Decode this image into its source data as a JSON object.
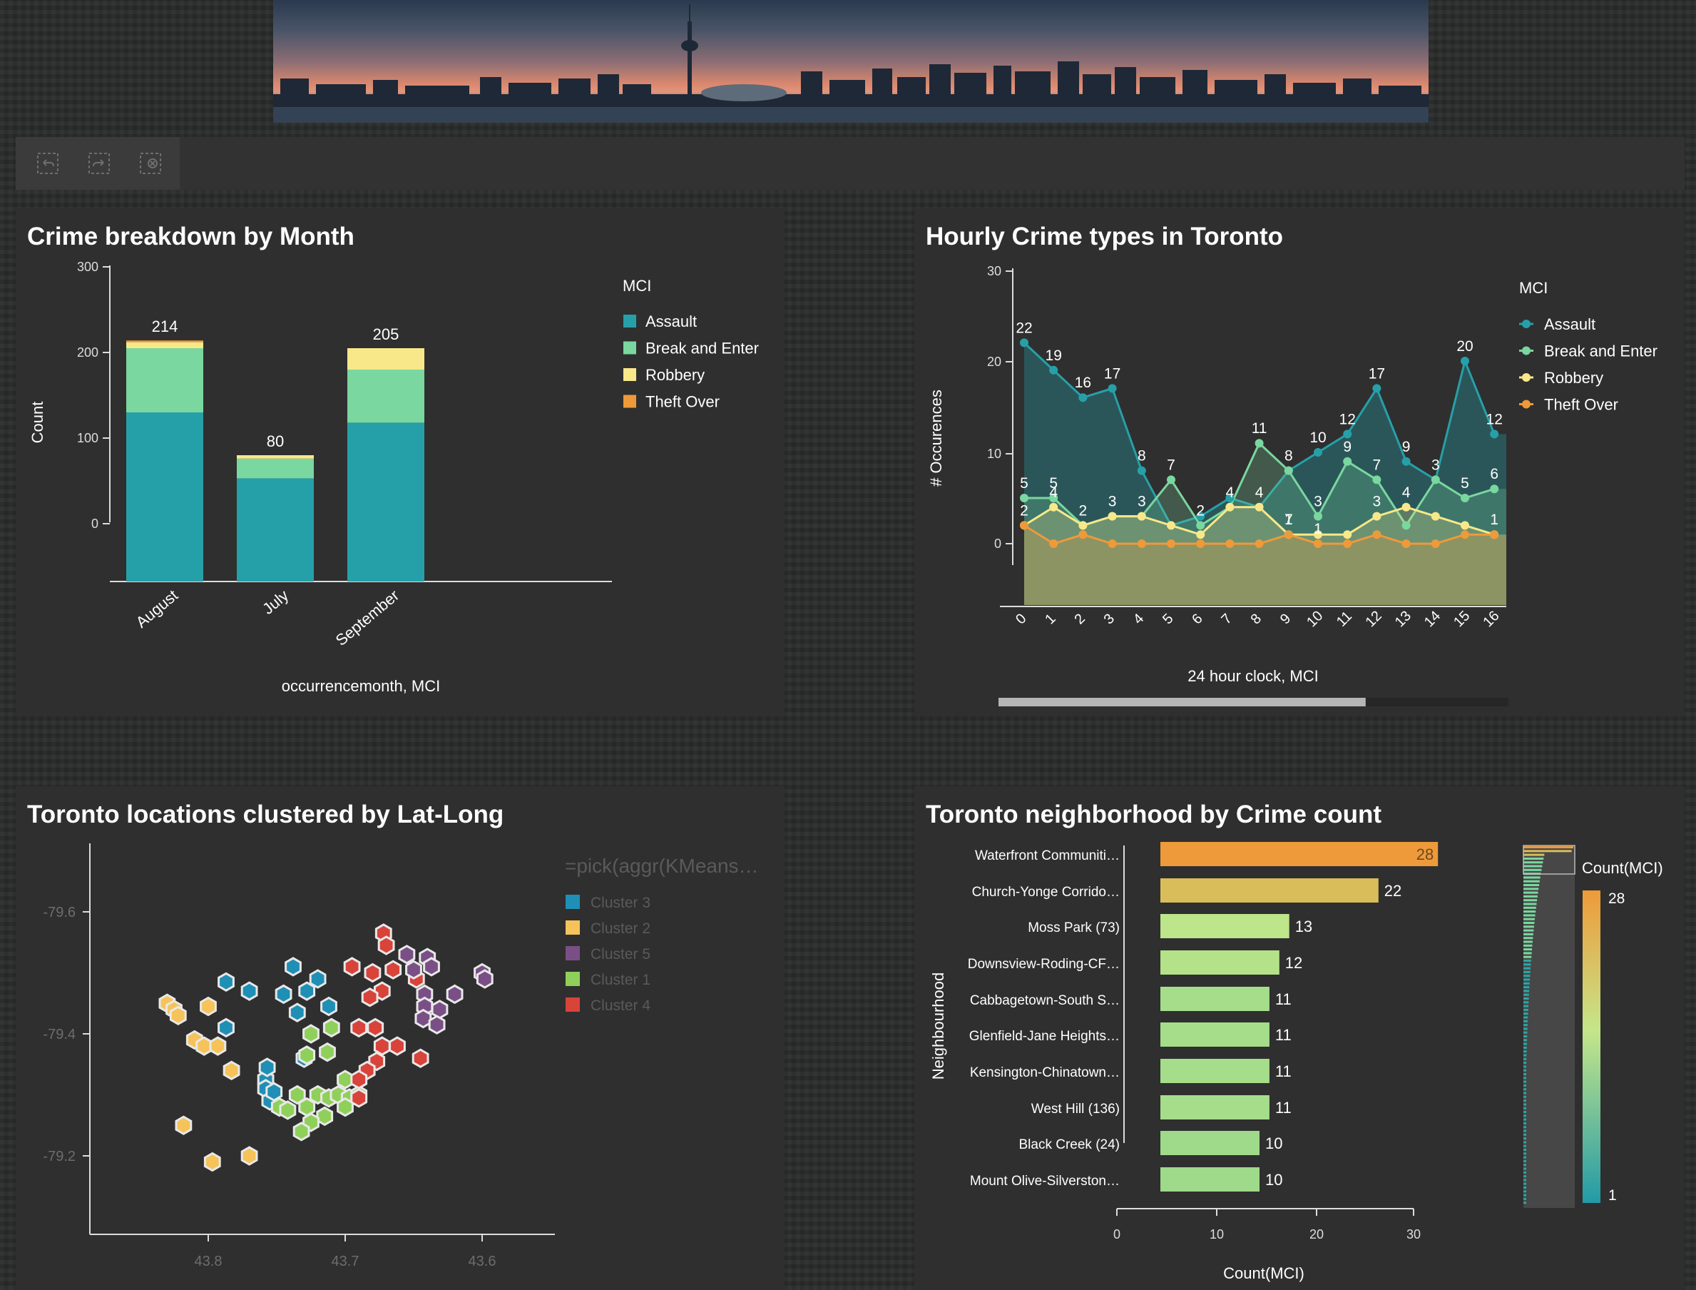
{
  "toolbar": {
    "buttons": [
      {
        "name": "undo-selection-icon"
      },
      {
        "name": "redo-selection-icon"
      },
      {
        "name": "clear-selection-icon"
      }
    ]
  },
  "month_chart": {
    "title": "Crime breakdown by Month",
    "chart_data": {
      "type": "bar",
      "stacked": true,
      "categories": [
        "August",
        "July",
        "September"
      ],
      "series": [
        {
          "name": "Assault",
          "color": "#26a0a8",
          "values": [
            130,
            53,
            118
          ]
        },
        {
          "name": "Break and Enter",
          "color": "#7ad79f",
          "values": [
            75,
            23,
            62
          ]
        },
        {
          "name": "Robbery",
          "color": "#f8e889",
          "values": [
            7,
            4,
            25
          ]
        },
        {
          "name": "Theft Over",
          "color": "#ee9a3a",
          "values": [
            2,
            0,
            0
          ]
        }
      ],
      "totals": [
        214,
        80,
        205
      ],
      "ylabel": "Count",
      "xlabel": "occurrencemonth, MCI",
      "yticks": [
        0,
        100,
        200,
        300
      ],
      "legend_title": "MCI",
      "legend_position": "right"
    }
  },
  "hourly_chart": {
    "title": "Hourly Crime types in Toronto",
    "chart_data": {
      "type": "area",
      "x": [
        0,
        1,
        2,
        3,
        4,
        5,
        6,
        7,
        8,
        9,
        10,
        11,
        12,
        13,
        14,
        15,
        16
      ],
      "series": [
        {
          "name": "Assault",
          "color": "#26a0a8",
          "values": [
            22,
            19,
            16,
            17,
            8,
            2,
            3,
            5,
            4,
            8,
            10,
            12,
            17,
            9,
            7,
            20,
            12
          ],
          "labels": [
            "22",
            "19",
            "16",
            "17",
            "8",
            "",
            "",
            "",
            "",
            "",
            "10",
            "12",
            "17",
            "9",
            "",
            "20",
            "12"
          ]
        },
        {
          "name": "Break and Enter",
          "color": "#7ad79f",
          "values": [
            5,
            5,
            2,
            3,
            3,
            7,
            2,
            4,
            11,
            8,
            3,
            9,
            7,
            2,
            7,
            5,
            6
          ],
          "labels": [
            "5",
            "5",
            "2",
            "3",
            "3",
            "7",
            "2",
            "4",
            "11",
            "8",
            "3",
            "9",
            "7",
            "",
            "3",
            "5",
            "6"
          ]
        },
        {
          "name": "Robbery",
          "color": "#f8e889",
          "values": [
            2,
            4,
            2,
            3,
            3,
            2,
            1,
            4,
            4,
            1,
            1,
            1,
            3,
            4,
            3,
            2,
            1
          ],
          "labels": [
            "2",
            "4",
            "",
            "",
            "",
            "",
            "",
            "",
            "4",
            "7",
            "",
            "",
            "3",
            "4",
            "",
            "",
            ""
          ]
        },
        {
          "name": "Theft Over",
          "color": "#ee9a3a",
          "values": [
            2,
            0,
            1,
            0,
            0,
            0,
            0,
            0,
            0,
            1,
            0,
            0,
            1,
            0,
            0,
            1,
            1
          ],
          "labels": [
            "",
            "",
            "",
            "",
            "",
            "",
            "",
            "",
            "",
            "1",
            "1",
            "",
            "",
            "",
            "",
            "",
            "1"
          ]
        }
      ],
      "ylabel": "# Occurences",
      "xlabel": "24 hour clock, MCI",
      "yticks": [
        0,
        10,
        20,
        30
      ],
      "legend_title": "MCI",
      "legend_position": "right",
      "scroll_visible_fraction": 0.72
    }
  },
  "cluster_chart": {
    "title": "Toronto locations clustered by Lat-Long",
    "chart_data": {
      "type": "scatter",
      "legend_title": "=pick(aggr(KMeans…",
      "legend": [
        {
          "name": "Cluster 3",
          "color": "#1f8fb5"
        },
        {
          "name": "Cluster 2",
          "color": "#f5c35a"
        },
        {
          "name": "Cluster 5",
          "color": "#7a4f86"
        },
        {
          "name": "Cluster 1",
          "color": "#8fd05a"
        },
        {
          "name": "Cluster 4",
          "color": "#d8433a"
        }
      ],
      "xticks": [
        "43.8",
        "43.7",
        "43.6"
      ],
      "yticks": [
        "-79.6",
        "-79.4",
        "-79.2"
      ],
      "x_range": [
        43.885,
        43.545
      ],
      "y_range": [
        -79.727,
        -79.092
      ],
      "points": [
        {
          "c": "Cluster 2",
          "x": 43.83,
          "y": -79.45
        },
        {
          "c": "Cluster 2",
          "x": 43.825,
          "y": -79.44
        },
        {
          "c": "Cluster 2",
          "x": 43.822,
          "y": -79.43
        },
        {
          "c": "Cluster 2",
          "x": 43.8,
          "y": -79.445
        },
        {
          "c": "Cluster 2",
          "x": 43.81,
          "y": -79.39
        },
        {
          "c": "Cluster 2",
          "x": 43.803,
          "y": -79.38
        },
        {
          "c": "Cluster 2",
          "x": 43.793,
          "y": -79.38
        },
        {
          "c": "Cluster 2",
          "x": 43.783,
          "y": -79.34
        },
        {
          "c": "Cluster 2",
          "x": 43.818,
          "y": -79.25
        },
        {
          "c": "Cluster 2",
          "x": 43.797,
          "y": -79.19
        },
        {
          "c": "Cluster 2",
          "x": 43.77,
          "y": -79.2
        },
        {
          "c": "Cluster 3",
          "x": 43.787,
          "y": -79.485
        },
        {
          "c": "Cluster 3",
          "x": 43.77,
          "y": -79.47
        },
        {
          "c": "Cluster 3",
          "x": 43.738,
          "y": -79.51
        },
        {
          "c": "Cluster 3",
          "x": 43.745,
          "y": -79.465
        },
        {
          "c": "Cluster 3",
          "x": 43.728,
          "y": -79.47
        },
        {
          "c": "Cluster 3",
          "x": 43.735,
          "y": -79.435
        },
        {
          "c": "Cluster 3",
          "x": 43.72,
          "y": -79.49
        },
        {
          "c": "Cluster 3",
          "x": 43.712,
          "y": -79.445
        },
        {
          "c": "Cluster 3",
          "x": 43.787,
          "y": -79.41
        },
        {
          "c": "Cluster 3",
          "x": 43.758,
          "y": -79.325
        },
        {
          "c": "Cluster 3",
          "x": 43.757,
          "y": -79.345
        },
        {
          "c": "Cluster 3",
          "x": 43.758,
          "y": -79.31
        },
        {
          "c": "Cluster 3",
          "x": 43.755,
          "y": -79.29
        },
        {
          "c": "Cluster 3",
          "x": 43.752,
          "y": -79.305
        },
        {
          "c": "Cluster 3",
          "x": 43.73,
          "y": -79.36
        },
        {
          "c": "Cluster 1",
          "x": 43.725,
          "y": -79.4
        },
        {
          "c": "Cluster 1",
          "x": 43.71,
          "y": -79.41
        },
        {
          "c": "Cluster 1",
          "x": 43.713,
          "y": -79.37
        },
        {
          "c": "Cluster 1",
          "x": 43.728,
          "y": -79.365
        },
        {
          "c": "Cluster 1",
          "x": 43.735,
          "y": -79.3
        },
        {
          "c": "Cluster 1",
          "x": 43.728,
          "y": -79.28
        },
        {
          "c": "Cluster 1",
          "x": 43.72,
          "y": -79.3
        },
        {
          "c": "Cluster 1",
          "x": 43.712,
          "y": -79.295
        },
        {
          "c": "Cluster 1",
          "x": 43.705,
          "y": -79.3
        },
        {
          "c": "Cluster 1",
          "x": 43.697,
          "y": -79.295
        },
        {
          "c": "Cluster 1",
          "x": 43.69,
          "y": -79.3
        },
        {
          "c": "Cluster 1",
          "x": 43.7,
          "y": -79.28
        },
        {
          "c": "Cluster 1",
          "x": 43.715,
          "y": -79.265
        },
        {
          "c": "Cluster 1",
          "x": 43.725,
          "y": -79.255
        },
        {
          "c": "Cluster 1",
          "x": 43.732,
          "y": -79.24
        },
        {
          "c": "Cluster 1",
          "x": 43.748,
          "y": -79.28
        },
        {
          "c": "Cluster 1",
          "x": 43.742,
          "y": -79.275
        },
        {
          "c": "Cluster 1",
          "x": 43.7,
          "y": -79.325
        },
        {
          "c": "Cluster 4",
          "x": 43.695,
          "y": -79.51
        },
        {
          "c": "Cluster 4",
          "x": 43.68,
          "y": -79.5
        },
        {
          "c": "Cluster 4",
          "x": 43.672,
          "y": -79.565
        },
        {
          "c": "Cluster 4",
          "x": 43.67,
          "y": -79.545
        },
        {
          "c": "Cluster 4",
          "x": 43.665,
          "y": -79.505
        },
        {
          "c": "Cluster 4",
          "x": 43.648,
          "y": -79.49
        },
        {
          "c": "Cluster 4",
          "x": 43.673,
          "y": -79.47
        },
        {
          "c": "Cluster 4",
          "x": 43.682,
          "y": -79.46
        },
        {
          "c": "Cluster 4",
          "x": 43.69,
          "y": -79.41
        },
        {
          "c": "Cluster 4",
          "x": 43.678,
          "y": -79.41
        },
        {
          "c": "Cluster 4",
          "x": 43.673,
          "y": -79.38
        },
        {
          "c": "Cluster 4",
          "x": 43.662,
          "y": -79.38
        },
        {
          "c": "Cluster 4",
          "x": 43.645,
          "y": -79.36
        },
        {
          "c": "Cluster 4",
          "x": 43.677,
          "y": -79.355
        },
        {
          "c": "Cluster 4",
          "x": 43.684,
          "y": -79.34
        },
        {
          "c": "Cluster 4",
          "x": 43.69,
          "y": -79.325
        },
        {
          "c": "Cluster 4",
          "x": 43.69,
          "y": -79.295
        },
        {
          "c": "Cluster 5",
          "x": 43.655,
          "y": -79.53
        },
        {
          "c": "Cluster 5",
          "x": 43.64,
          "y": -79.525
        },
        {
          "c": "Cluster 5",
          "x": 43.637,
          "y": -79.51
        },
        {
          "c": "Cluster 5",
          "x": 43.65,
          "y": -79.505
        },
        {
          "c": "Cluster 5",
          "x": 43.6,
          "y": -79.5
        },
        {
          "c": "Cluster 5",
          "x": 43.598,
          "y": -79.49
        },
        {
          "c": "Cluster 5",
          "x": 43.62,
          "y": -79.465
        },
        {
          "c": "Cluster 5",
          "x": 43.642,
          "y": -79.465
        },
        {
          "c": "Cluster 5",
          "x": 43.642,
          "y": -79.445
        },
        {
          "c": "Cluster 5",
          "x": 43.631,
          "y": -79.44
        },
        {
          "c": "Cluster 5",
          "x": 43.643,
          "y": -79.425
        },
        {
          "c": "Cluster 5",
          "x": 43.633,
          "y": -79.415
        }
      ]
    }
  },
  "neighborhood_chart": {
    "title": "Toronto neighborhood by Crime count",
    "chart_data": {
      "type": "bar",
      "orientation": "horizontal",
      "categories": [
        "Waterfront Communiti…",
        "Church-Yonge Corrido…",
        "Moss Park (73)",
        "Downsview-Roding-CF…",
        "Cabbagetown-South S…",
        "Glenfield-Jane Heights…",
        "Kensington-Chinatown…",
        "West Hill (136)",
        "Black Creek (24)",
        "Mount Olive-Silverston…"
      ],
      "values": [
        28,
        22,
        13,
        12,
        11,
        11,
        11,
        11,
        10,
        10
      ],
      "colors": [
        "#ee9a3a",
        "#d9bd5a",
        "#bde58a",
        "#b3e288",
        "#a6dd8a",
        "#a6dd8a",
        "#a6dd8a",
        "#a6dd8a",
        "#9fd98a",
        "#9fd98a"
      ],
      "ylabel": "Neighbourhood",
      "xlabel": "Count(MCI)",
      "xticks": [
        0,
        10,
        20,
        30
      ],
      "legend_title": "Count(MCI)",
      "legend_max": "28",
      "legend_min": "1"
    }
  }
}
